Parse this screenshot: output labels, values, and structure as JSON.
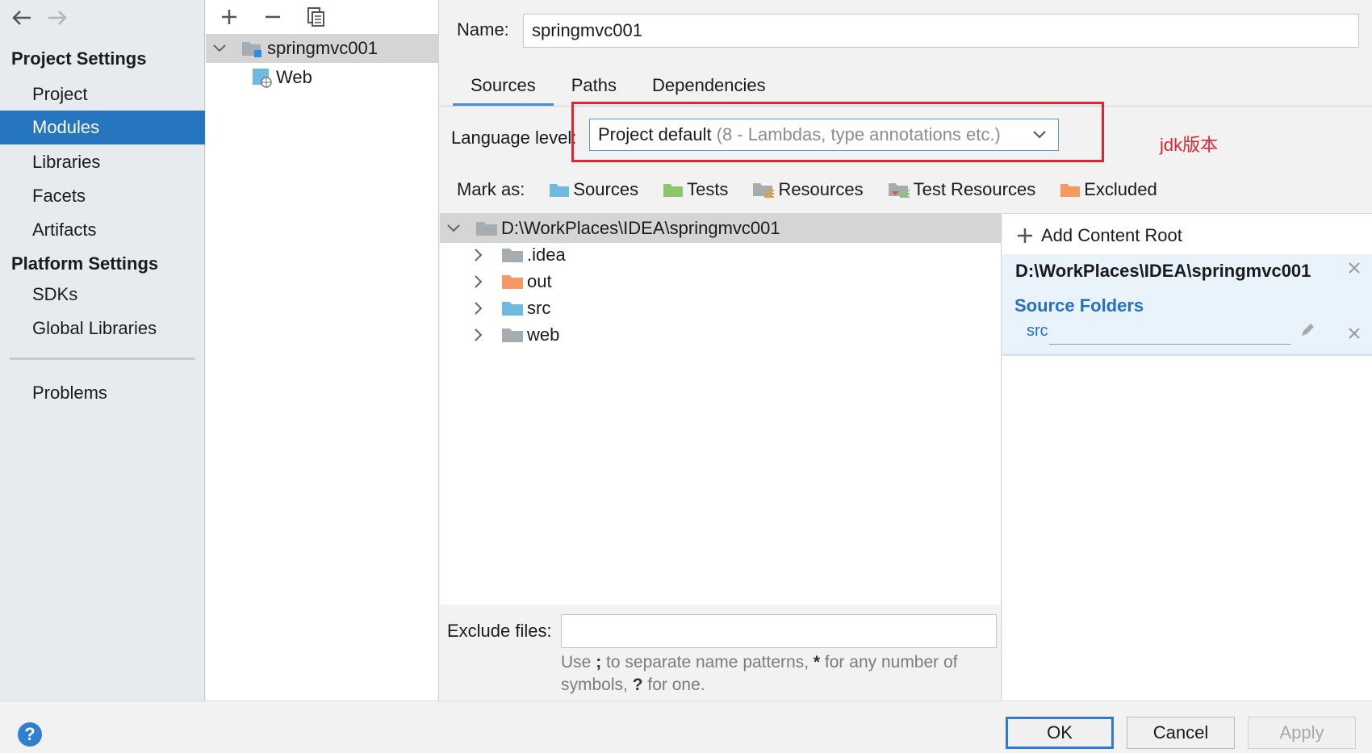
{
  "sidebar": {
    "back_icon": "arrow-left-icon",
    "forward_icon": "arrow-right-icon",
    "project_settings_title": "Project Settings",
    "project_items": [
      "Project",
      "Modules",
      "Libraries",
      "Facets",
      "Artifacts"
    ],
    "platform_settings_title": "Platform Settings",
    "platform_items": [
      "SDKs",
      "Global Libraries"
    ],
    "problems": "Problems",
    "selected": "Modules"
  },
  "module_tree": {
    "module_name": "springmvc001",
    "facet_name": "Web"
  },
  "main": {
    "name_label": "Name:",
    "name_value": "springmvc001",
    "tabs": [
      "Sources",
      "Paths",
      "Dependencies"
    ],
    "active_tab": "Sources",
    "language_level_label": "Language level:",
    "language_level_value": "Project default",
    "language_level_hint": "(8 - Lambdas, type annotations etc.)",
    "annotation": "jdk版本",
    "annotation_color": "#e0262e",
    "mark_as_label": "Mark as:",
    "mark_as": [
      "Sources",
      "Tests",
      "Resources",
      "Test Resources",
      "Excluded"
    ],
    "file_tree": {
      "root": "D:\\WorkPlaces\\IDEA\\springmvc001",
      "children": [
        ".idea",
        "out",
        "src",
        "web"
      ]
    },
    "exclude_label": "Exclude files:",
    "exclude_value": "",
    "exclude_hint_1": "Use",
    "exclude_hint_semicolon": ";",
    "exclude_hint_2": "to separate name patterns,",
    "exclude_hint_star": "*",
    "exclude_hint_3": "for any number of symbols,",
    "exclude_hint_q": "?",
    "exclude_hint_4": "for one.",
    "roots": {
      "add_label": "Add Content Root",
      "path": "D:\\WorkPlaces\\IDEA\\springmvc001",
      "source_folders_title": "Source Folders",
      "source_folder": "src"
    }
  },
  "buttons": {
    "ok": "OK",
    "cancel": "Cancel",
    "apply": "Apply",
    "help": "?"
  },
  "colors": {
    "selection": "#2675bf",
    "accent": "#4a8fd6",
    "source_folder": "#6fbadf",
    "test_folder": "#8cc66b",
    "excluded_folder": "#f39a64"
  }
}
